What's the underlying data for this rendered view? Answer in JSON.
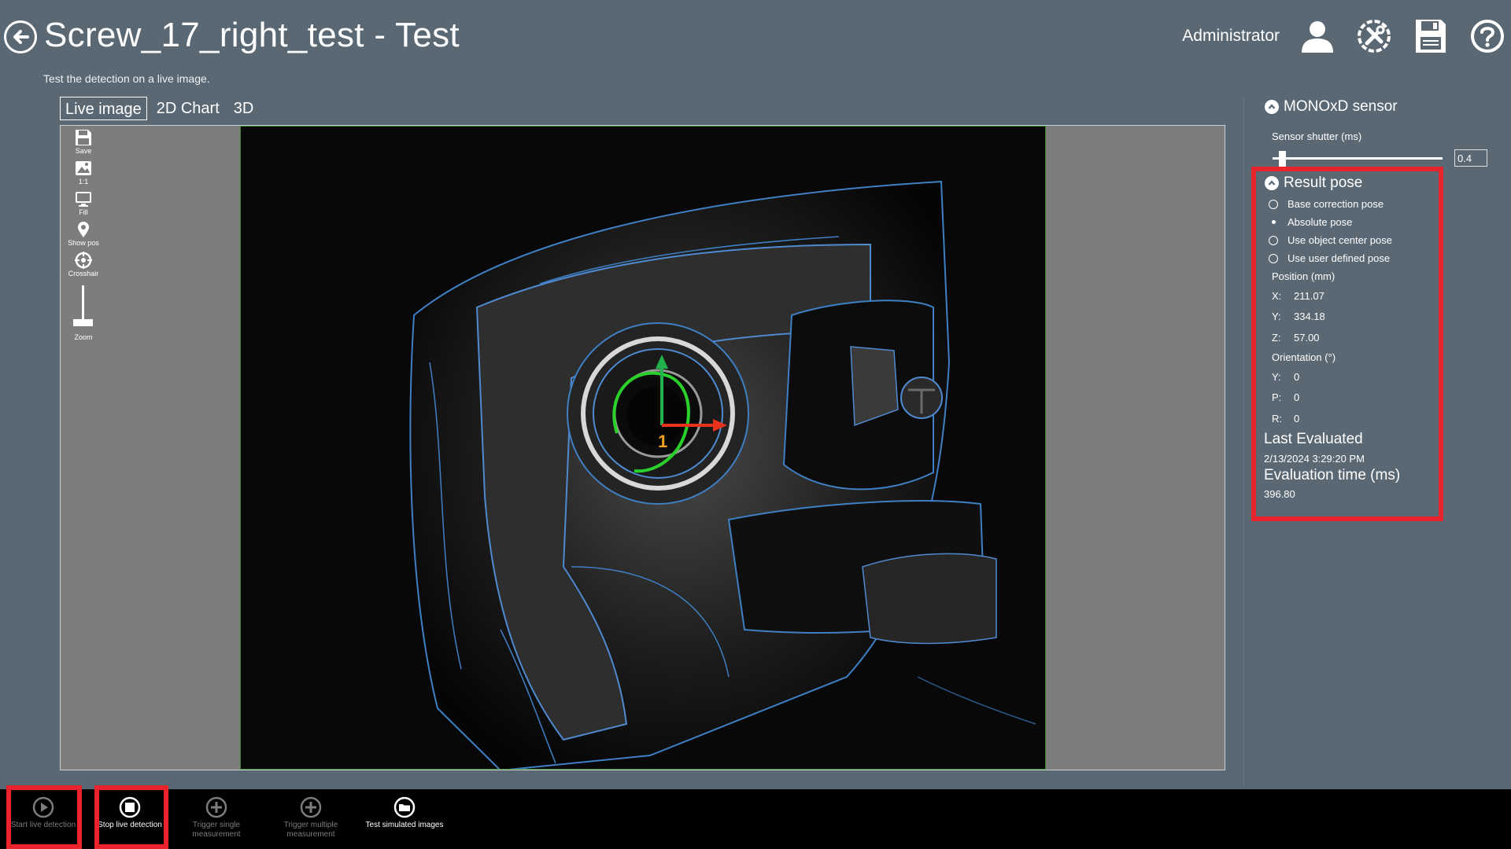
{
  "header": {
    "title": "Screw_17_right_test - Test",
    "subtitle": "Test the detection on a live image.",
    "user": "Administrator",
    "icons": [
      "back-arrow-icon",
      "user-icon",
      "tools-icon",
      "save-icon",
      "help-icon"
    ]
  },
  "tabs": [
    {
      "label": "Live image",
      "active": true
    },
    {
      "label": "2D Chart",
      "active": false
    },
    {
      "label": "3D",
      "active": false
    }
  ],
  "toolbar": {
    "save": "Save",
    "one_to_one": "1:1",
    "fill": "Fill",
    "show_pos": "Show pos",
    "crosshair": "Crosshair",
    "zoom": "Zoom"
  },
  "viewer": {
    "marker_label": "1"
  },
  "sensor": {
    "title": "MONOxD sensor",
    "shutter_label": "Sensor shutter (ms)",
    "shutter_value": "0.4"
  },
  "result": {
    "title": "Result pose",
    "options": [
      {
        "label": "Base correction pose",
        "selected": false
      },
      {
        "label": "Absolute pose",
        "selected": true
      },
      {
        "label": "Use object center pose",
        "selected": false
      },
      {
        "label": "Use user defined pose",
        "selected": false
      }
    ],
    "position_label": "Position (mm)",
    "x_label": "X:",
    "x_value": "211.07",
    "y_label": "Y:",
    "y_value": "334.18",
    "z_label": "Z:",
    "z_value": "57.00",
    "orientation_label": "Orientation (°)",
    "oy_label": "Y:",
    "oy_value": "0",
    "op_label": "P:",
    "op_value": "0",
    "or_label": "R:",
    "or_value": "0",
    "last_evaluated_label": "Last Evaluated",
    "last_evaluated_value": "2/13/2024 3:29:20 PM",
    "eval_time_label": "Evaluation time (ms)",
    "eval_time_value": "396.80"
  },
  "bottom_bar": {
    "start_live": "Start live detection",
    "stop_live": "Stop live detection",
    "trigger_single": "Trigger single measurement",
    "trigger_multiple": "Trigger multiple measurement",
    "test_simulated": "Test simulated images"
  },
  "colors": {
    "background": "#5a6874",
    "highlight": "#e8232b",
    "image_border": "#3c8a2c"
  }
}
